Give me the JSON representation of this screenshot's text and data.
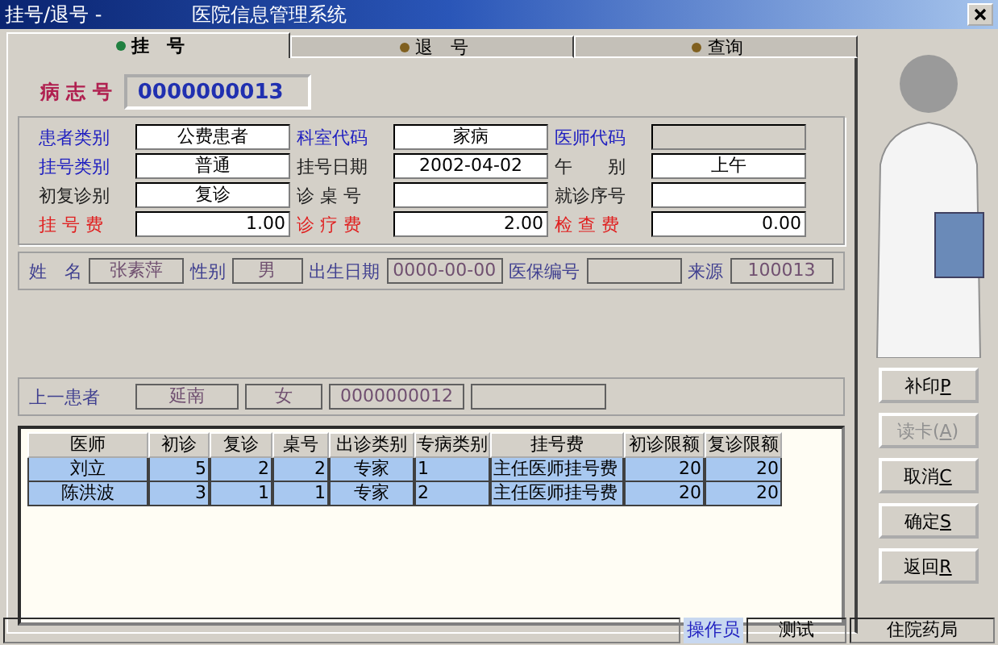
{
  "window": {
    "title_left": "挂号/退号 -",
    "title": "医院信息管理系统"
  },
  "tabs": [
    {
      "label": "挂　号",
      "selected": true
    },
    {
      "label": "退　号",
      "selected": false
    },
    {
      "label": "查询",
      "selected": false
    }
  ],
  "record": {
    "label": "病 志 号",
    "value": "0000000013"
  },
  "form": [
    [
      {
        "label": "患者类别",
        "color": "#2020c0",
        "value": "公费患者",
        "kind": "text",
        "disabled": false
      },
      {
        "label": "科室代码",
        "color": "#2020c0",
        "value": "家病",
        "kind": "text",
        "disabled": false
      },
      {
        "label": "医师代码",
        "color": "#2020c0",
        "kind": "text",
        "disabled": true
      }
    ],
    [
      {
        "label": "挂号类别",
        "color": "#2020c0",
        "value": "普通",
        "kind": "text",
        "disabled": false
      },
      {
        "label": "挂号日期",
        "color": "#202020",
        "value": "2002-04-02",
        "kind": "text",
        "disabled": false
      },
      {
        "label": "午　　别",
        "color": "#202020",
        "value": "上午",
        "kind": "text",
        "disabled": false
      }
    ],
    [
      {
        "label": "初复诊别",
        "color": "#202020",
        "value": "复诊",
        "kind": "text",
        "disabled": false
      },
      {
        "label": "诊 桌 号",
        "color": "#202020",
        "kind": "text",
        "disabled": false
      },
      {
        "label": "就诊序号",
        "color": "#202020",
        "kind": "text",
        "disabled": false
      }
    ],
    [
      {
        "label": "挂 号 费",
        "color": "#e02020",
        "value": "1.00",
        "kind": "money",
        "disabled": false
      },
      {
        "label": "诊 疗 费",
        "color": "#e02020",
        "value": "2.00",
        "kind": "money",
        "disabled": false
      },
      {
        "label": "检 查 费",
        "color": "#e02020",
        "value": "0.00",
        "kind": "money",
        "disabled": false
      }
    ]
  ],
  "patient": [
    {
      "label": "姓　名",
      "value": "张素萍"
    },
    {
      "label": "性别",
      "value": "男"
    },
    {
      "label": "出生日期",
      "value": "0000-00-00"
    },
    {
      "label": "医保编号"
    },
    {
      "label": "来源",
      "value": "100013"
    }
  ],
  "previous": {
    "label": "上一患者",
    "values": [
      "延南",
      "女",
      "0000000012"
    ]
  },
  "table": {
    "columns": [
      "医师",
      "初诊",
      "复诊",
      "桌号",
      "出诊类别",
      "专病类别",
      "挂号费",
      "初诊限额",
      "复诊限额"
    ],
    "rows": [
      [
        "刘立",
        "5",
        "2",
        "2",
        "专家",
        "1",
        "主任医师挂号费",
        "20",
        "20"
      ],
      [
        "陈洪波",
        "3",
        "1",
        "1",
        "专家",
        "2",
        "主任医师挂号费",
        "20",
        "20"
      ]
    ]
  },
  "buttons": [
    {
      "label": "补印",
      "key": "P",
      "disabled": false
    },
    {
      "label": "读卡(",
      "key": "A",
      "after": ")",
      "disabled": true
    },
    {
      "label": "取消",
      "key": "C",
      "disabled": false
    },
    {
      "label": "确定",
      "key": "S",
      "disabled": false
    },
    {
      "label": "返回",
      "key": "R",
      "disabled": false
    }
  ],
  "status_bar": {
    "operator_label": "操作员",
    "operator": "测试",
    "department": "住院药局"
  }
}
